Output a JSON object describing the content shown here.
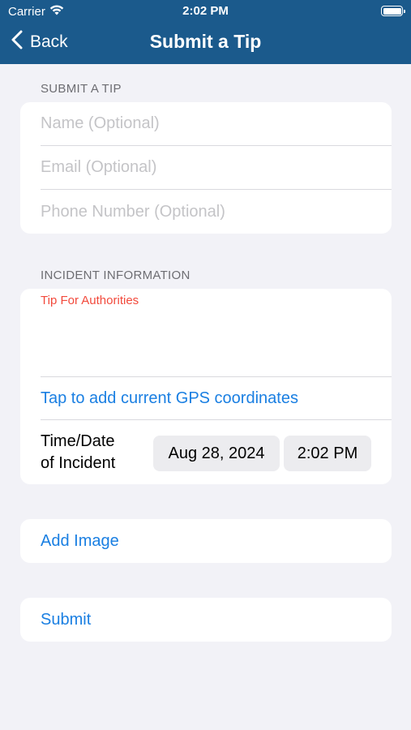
{
  "status_bar": {
    "carrier": "Carrier",
    "time": "2:02 PM"
  },
  "nav": {
    "back_label": "Back",
    "title": "Submit a Tip"
  },
  "submit_section": {
    "header": "SUBMIT A TIP",
    "name_placeholder": "Name (Optional)",
    "email_placeholder": "Email (Optional)",
    "phone_placeholder": "Phone Number (Optional)"
  },
  "incident_section": {
    "header": "INCIDENT INFORMATION",
    "tip_label": "Tip For Authorities",
    "gps_link": "Tap to add current GPS coordinates",
    "time_label_line1": "Time/Date",
    "time_label_line2": "of Incident",
    "date_value": "Aug 28, 2024",
    "time_value": "2:02 PM"
  },
  "actions": {
    "add_image_label": "Add Image",
    "submit_label": "Submit"
  },
  "colors": {
    "nav_bar": "#1b5a8c",
    "link": "#1a7fe2",
    "tip_label": "#f24a3c",
    "background": "#f2f2f7"
  }
}
